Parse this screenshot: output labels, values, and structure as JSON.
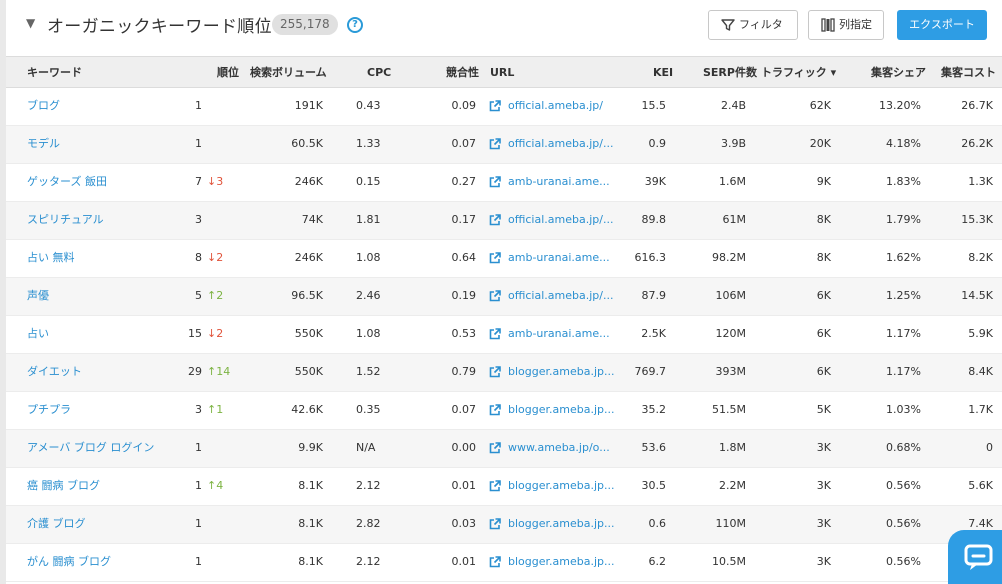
{
  "header": {
    "collapse_glyph": "▼",
    "title": "オーガニックキーワード順位",
    "count": "255,178",
    "help_glyph": "?"
  },
  "toolbar": {
    "filter_label": "フィルタ",
    "columns_label": "列指定",
    "export_label": "エクスポート"
  },
  "table": {
    "headers": {
      "keyword": "キーワード",
      "rank": "順位",
      "volume": "検索ボリューム",
      "cpc": "CPC",
      "competition": "競合性",
      "url": "URL",
      "kei": "KEI",
      "serp": "SERP件数",
      "traffic": "トラフィック ▾",
      "share": "集客シェア",
      "cost": "集客コスト"
    },
    "rows": [
      {
        "keyword": "ブログ",
        "rank": "1",
        "change": "",
        "dir": "",
        "volume": "191K",
        "cpc": "0.43",
        "competition": "0.09",
        "url": "official.ameba.jp/",
        "kei": "15.5",
        "serp": "2.4B",
        "traffic": "62K",
        "share": "13.20%",
        "cost": "26.7K"
      },
      {
        "keyword": "モデル",
        "rank": "1",
        "change": "",
        "dir": "",
        "volume": "60.5K",
        "cpc": "1.33",
        "competition": "0.07",
        "url": "official.ameba.jp/...",
        "kei": "0.9",
        "serp": "3.9B",
        "traffic": "20K",
        "share": "4.18%",
        "cost": "26.2K"
      },
      {
        "keyword": "ゲッターズ 飯田",
        "rank": "7",
        "change": "↓3",
        "dir": "down",
        "volume": "246K",
        "cpc": "0.15",
        "competition": "0.27",
        "url": "amb-uranai.ame...",
        "kei": "39K",
        "serp": "1.6M",
        "traffic": "9K",
        "share": "1.83%",
        "cost": "1.3K"
      },
      {
        "keyword": "スピリチュアル",
        "rank": "3",
        "change": "",
        "dir": "",
        "volume": "74K",
        "cpc": "1.81",
        "competition": "0.17",
        "url": "official.ameba.jp/...",
        "kei": "89.8",
        "serp": "61M",
        "traffic": "8K",
        "share": "1.79%",
        "cost": "15.3K"
      },
      {
        "keyword": "占い 無料",
        "rank": "8",
        "change": "↓2",
        "dir": "down",
        "volume": "246K",
        "cpc": "1.08",
        "competition": "0.64",
        "url": "amb-uranai.ame...",
        "kei": "616.3",
        "serp": "98.2M",
        "traffic": "8K",
        "share": "1.62%",
        "cost": "8.2K"
      },
      {
        "keyword": "声優",
        "rank": "5",
        "change": "↑2",
        "dir": "up",
        "volume": "96.5K",
        "cpc": "2.46",
        "competition": "0.19",
        "url": "official.ameba.jp/...",
        "kei": "87.9",
        "serp": "106M",
        "traffic": "6K",
        "share": "1.25%",
        "cost": "14.5K"
      },
      {
        "keyword": "占い",
        "rank": "15",
        "change": "↓2",
        "dir": "down",
        "volume": "550K",
        "cpc": "1.08",
        "competition": "0.53",
        "url": "amb-uranai.ame...",
        "kei": "2.5K",
        "serp": "120M",
        "traffic": "6K",
        "share": "1.17%",
        "cost": "5.9K"
      },
      {
        "keyword": "ダイエット",
        "rank": "29",
        "change": "↑14",
        "dir": "up",
        "volume": "550K",
        "cpc": "1.52",
        "competition": "0.79",
        "url": "blogger.ameba.jp...",
        "kei": "769.7",
        "serp": "393M",
        "traffic": "6K",
        "share": "1.17%",
        "cost": "8.4K"
      },
      {
        "keyword": "プチプラ",
        "rank": "3",
        "change": "↑1",
        "dir": "up",
        "volume": "42.6K",
        "cpc": "0.35",
        "competition": "0.07",
        "url": "blogger.ameba.jp...",
        "kei": "35.2",
        "serp": "51.5M",
        "traffic": "5K",
        "share": "1.03%",
        "cost": "1.7K"
      },
      {
        "keyword": "アメーバ ブログ ログイン",
        "rank": "1",
        "change": "",
        "dir": "",
        "volume": "9.9K",
        "cpc": "N/A",
        "competition": "0.00",
        "url": "www.ameba.jp/o...",
        "kei": "53.6",
        "serp": "1.8M",
        "traffic": "3K",
        "share": "0.68%",
        "cost": "0"
      },
      {
        "keyword": "癌 闘病 ブログ",
        "rank": "1",
        "change": "↑4",
        "dir": "up",
        "volume": "8.1K",
        "cpc": "2.12",
        "competition": "0.01",
        "url": "blogger.ameba.jp...",
        "kei": "30.5",
        "serp": "2.2M",
        "traffic": "3K",
        "share": "0.56%",
        "cost": "5.6K"
      },
      {
        "keyword": "介護 ブログ",
        "rank": "1",
        "change": "",
        "dir": "",
        "volume": "8.1K",
        "cpc": "2.82",
        "competition": "0.03",
        "url": "blogger.ameba.jp...",
        "kei": "0.6",
        "serp": "110M",
        "traffic": "3K",
        "share": "0.56%",
        "cost": "7.4K"
      },
      {
        "keyword": "がん 闘病 ブログ",
        "rank": "1",
        "change": "",
        "dir": "",
        "volume": "8.1K",
        "cpc": "2.12",
        "competition": "0.01",
        "url": "blogger.ameba.jp...",
        "kei": "6.2",
        "serp": "10.5M",
        "traffic": "3K",
        "share": "0.56%",
        "cost": ""
      }
    ]
  },
  "colors": {
    "link": "#2a8fd0",
    "primary_button": "#2e9de4",
    "rank_up": "#7cb342",
    "rank_down": "#e0533a",
    "header_bg": "#efefef",
    "alt_row_bg": "#f6f6f6"
  },
  "icons": {
    "filter": "funnel-icon",
    "columns": "columns-icon",
    "external_link": "external-link-icon",
    "help": "help-icon",
    "chat": "chat-icon"
  }
}
